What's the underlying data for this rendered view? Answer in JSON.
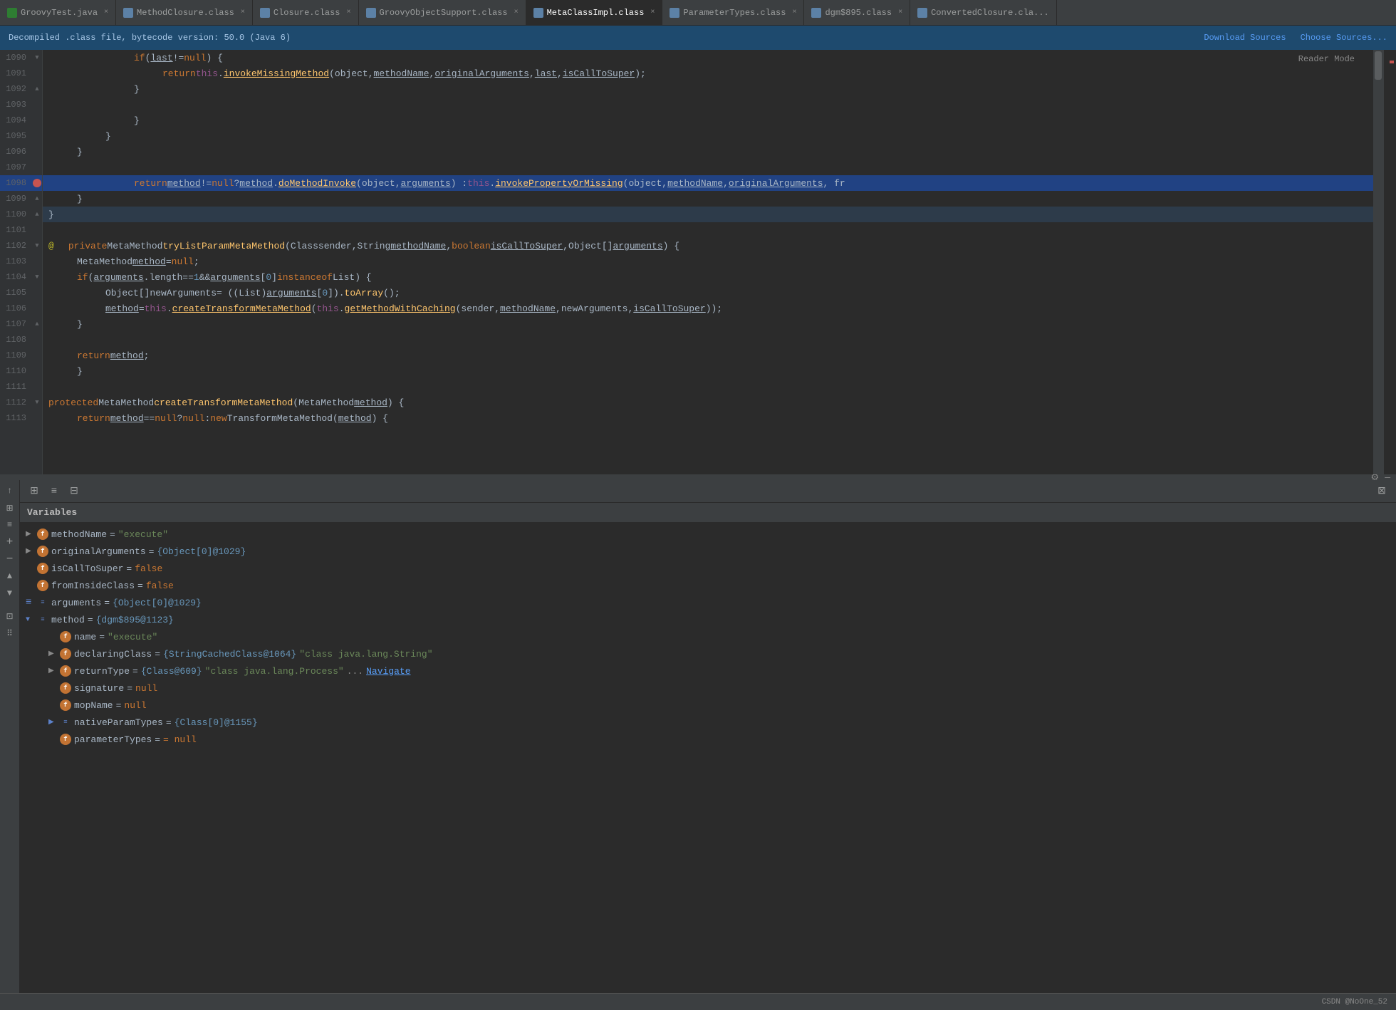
{
  "tabs": [
    {
      "id": "groovy-test",
      "label": "GroovyTest.java",
      "active": false,
      "icon": "groovy"
    },
    {
      "id": "method-closure",
      "label": "MethodClosure.class",
      "active": false,
      "icon": "class"
    },
    {
      "id": "closure",
      "label": "Closure.class",
      "active": false,
      "icon": "class"
    },
    {
      "id": "groovy-object-support",
      "label": "GroovyObjectSupport.class",
      "active": false,
      "icon": "class"
    },
    {
      "id": "meta-class-impl",
      "label": "MetaClassImpl.class",
      "active": true,
      "icon": "class"
    },
    {
      "id": "parameter-types",
      "label": "ParameterTypes.class",
      "active": false,
      "icon": "class"
    },
    {
      "id": "dgm895",
      "label": "dgm$895.class",
      "active": false,
      "icon": "class"
    },
    {
      "id": "converted-closure",
      "label": "ConvertedClosure.cla...",
      "active": false,
      "icon": "class"
    }
  ],
  "info_bar": {
    "message": "Decompiled .class file, bytecode version: 50.0 (Java 6)",
    "download_sources": "Download Sources",
    "choose_sources": "Choose Sources..."
  },
  "reader_mode": "Reader Mode",
  "code_lines": [
    {
      "num": 1090,
      "indent": 3,
      "content": "if (last != null) {",
      "marker": "fold"
    },
    {
      "num": 1091,
      "indent": 4,
      "content": "return this.invokeMissingMethod(object, methodName, originalArguments, last, isCallToSuper);",
      "marker": ""
    },
    {
      "num": 1092,
      "indent": 3,
      "content": "}",
      "marker": "fold"
    },
    {
      "num": 1093,
      "indent": 3,
      "content": "",
      "marker": ""
    },
    {
      "num": 1094,
      "indent": 3,
      "content": "}",
      "marker": ""
    },
    {
      "num": 1095,
      "indent": 2,
      "content": "}",
      "marker": ""
    },
    {
      "num": 1096,
      "indent": 1,
      "content": "}",
      "marker": ""
    },
    {
      "num": 1097,
      "indent": 0,
      "content": "",
      "marker": ""
    },
    {
      "num": 1098,
      "indent": 0,
      "content": "return method != null ? method.doMethodInvoke(object, arguments) : this.invokePropertyOrMissing(object, methodName, originalArguments, fr",
      "marker": "breakpoint",
      "highlighted": true
    },
    {
      "num": 1099,
      "indent": 1,
      "content": "}",
      "marker": "fold"
    },
    {
      "num": 1100,
      "indent": 0,
      "content": "}",
      "marker": "fold"
    },
    {
      "num": 1101,
      "indent": 0,
      "content": "",
      "marker": ""
    },
    {
      "num": 1102,
      "indent": 0,
      "content": "private MetaMethod tryListParamMetaMethod(Class sender, String methodName, boolean isCallToSuper, Object[] arguments) {",
      "marker": "fold",
      "anno": true
    },
    {
      "num": 1103,
      "indent": 1,
      "content": "MetaMethod method = null;",
      "marker": ""
    },
    {
      "num": 1104,
      "indent": 1,
      "content": "if (arguments.length == 1 && arguments[0] instanceof List) {",
      "marker": "fold"
    },
    {
      "num": 1105,
      "indent": 2,
      "content": "Object[] newArguments = ((List)arguments[0]).toArray();",
      "marker": ""
    },
    {
      "num": 1106,
      "indent": 2,
      "content": "method = this.createTransformMetaMethod(this.getMethodWithCaching(sender, methodName, newArguments, isCallToSuper));",
      "marker": ""
    },
    {
      "num": 1107,
      "indent": 1,
      "content": "}",
      "marker": "fold"
    },
    {
      "num": 1108,
      "indent": 0,
      "content": "",
      "marker": ""
    },
    {
      "num": 1109,
      "indent": 1,
      "content": "return method;",
      "marker": ""
    },
    {
      "num": 1110,
      "indent": 1,
      "content": "}",
      "marker": ""
    },
    {
      "num": 1111,
      "indent": 0,
      "content": "",
      "marker": ""
    },
    {
      "num": 1112,
      "indent": 0,
      "content": "protected MetaMethod createTransformMetaMethod(MetaMethod method) {",
      "marker": "fold"
    },
    {
      "num": 1113,
      "indent": 1,
      "content": "return method == null ? null : new TransformMetaMethod(method) {",
      "marker": ""
    }
  ],
  "debug_toolbar": {
    "icons": [
      "table",
      "list",
      "split"
    ]
  },
  "variables_label": "Variables",
  "variables": [
    {
      "id": "methodName",
      "expand": true,
      "expanded": true,
      "icon": "orange",
      "icon_label": "f",
      "name": "methodName",
      "eq": "=",
      "value": "\"execute\"",
      "value_type": "str",
      "indent": 0
    },
    {
      "id": "originalArguments",
      "expand": false,
      "expanded": false,
      "icon": "orange",
      "icon_label": "f",
      "name": "originalArguments",
      "eq": "=",
      "value": "{Object[0]@1029}",
      "value_type": "default",
      "indent": 0
    },
    {
      "id": "isCallToSuper",
      "expand": false,
      "expanded": false,
      "icon": "orange",
      "icon_label": "f",
      "name": "isCallToSuper",
      "eq": "=",
      "value": "false",
      "value_type": "bool",
      "indent": 0
    },
    {
      "id": "fromInsideClass",
      "expand": false,
      "expanded": false,
      "icon": "orange",
      "icon_label": "f",
      "name": "fromInsideClass",
      "eq": "=",
      "value": "false",
      "value_type": "bool",
      "indent": 0
    },
    {
      "id": "arguments",
      "expand": false,
      "expanded": false,
      "icon": "blue-arr",
      "icon_label": "≡",
      "name": "arguments",
      "eq": "=",
      "value": "{Object[0]@1029}",
      "value_type": "default",
      "indent": 0
    },
    {
      "id": "method",
      "expand": false,
      "expanded": false,
      "icon": "blue-arr",
      "icon_label": "≡",
      "name": "method",
      "eq": "=",
      "value": "{dgm$895@1123}",
      "value_type": "default",
      "indent": 0,
      "is_expanded_parent": true
    },
    {
      "id": "method-name",
      "expand": false,
      "icon": "orange",
      "icon_label": "f",
      "name": "name",
      "eq": "=",
      "value": "\"execute\"",
      "value_type": "str",
      "indent": 2
    },
    {
      "id": "method-declaringClass",
      "expand": true,
      "expanded": false,
      "icon": "orange",
      "icon_label": "f",
      "name": "declaringClass",
      "eq": "=",
      "value": "{StringCachedClass@1064}",
      "value_type": "default",
      "extra": "\"class java.lang.String\"",
      "indent": 2
    },
    {
      "id": "method-returnType",
      "expand": true,
      "expanded": false,
      "icon": "orange",
      "icon_label": "f",
      "name": "returnType",
      "eq": "=",
      "value": "{Class@609}",
      "value_type": "default",
      "extra": "\"class java.lang.Process\"",
      "link": "Navigate",
      "indent": 2
    },
    {
      "id": "method-signature",
      "expand": false,
      "icon": "orange",
      "icon_label": "f",
      "name": "signature",
      "eq": "=",
      "value": "null",
      "value_type": "null",
      "indent": 2
    },
    {
      "id": "method-mopName",
      "expand": false,
      "icon": "orange",
      "icon_label": "f",
      "name": "mopName",
      "eq": "=",
      "value": "null",
      "value_type": "null",
      "indent": 2
    },
    {
      "id": "method-nativeParamTypes",
      "expand": false,
      "icon": "blue-arr",
      "icon_label": "≡",
      "name": "nativeParamTypes",
      "eq": "=",
      "value": "{Class[0]@1155}",
      "value_type": "default",
      "indent": 2
    },
    {
      "id": "method-parameterTypes",
      "expand": false,
      "icon": "orange",
      "icon_label": "f",
      "name": "parameterTypes",
      "eq": "=",
      "value": "= null",
      "value_type": "null",
      "indent": 2,
      "partial": true
    }
  ],
  "status_bar": {
    "text": "CSDN @NoOne_52"
  }
}
